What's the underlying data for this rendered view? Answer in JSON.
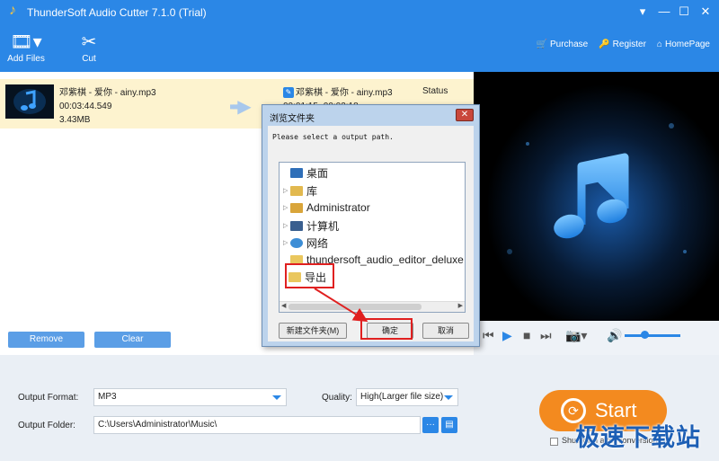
{
  "window": {
    "title": "ThunderSoft Audio Cutter 7.1.0 (Trial)",
    "controls": [
      "▾",
      "—",
      "☐",
      "✕"
    ]
  },
  "toolbar": {
    "add_files": "Add Files",
    "cut": "Cut"
  },
  "nav": {
    "purchase": "Purchase",
    "register": "Register",
    "homepage": "HomePage"
  },
  "file": {
    "source_name": "邓紫棋 - 爱你 - ainy.mp3",
    "source_duration": "00:03:44.549",
    "source_size": "3.43MB",
    "output_name": "邓紫棋 - 爱你 - ainy.mp3",
    "output_range": "00:01:15~00:02:18",
    "status_label": "Status"
  },
  "list_buttons": {
    "remove": "Remove",
    "clear": "Clear"
  },
  "settings": {
    "output_format_label": "Output Format:",
    "output_format_value": "MP3",
    "quality_label": "Quality:",
    "quality_value": "High(Larger file size)",
    "output_folder_label": "Output Folder:",
    "output_folder_value": "C:\\Users\\Administrator\\Music\\",
    "browse": "···",
    "open_folder": "▤"
  },
  "start": {
    "label": "Start",
    "checkbox_label": "Shutdown after conversion"
  },
  "dialog": {
    "title": "浏览文件夹",
    "close": "✕",
    "message": "Please select a output path.",
    "tree": [
      {
        "label": "桌面",
        "expander": ""
      },
      {
        "label": "库",
        "expander": "▷"
      },
      {
        "label": "Administrator",
        "expander": "▷"
      },
      {
        "label": "计算机",
        "expander": "▷"
      },
      {
        "label": "网络",
        "expander": "▷"
      },
      {
        "label": "thundersoft_audio_editor_deluxe",
        "expander": ""
      },
      {
        "label": "导出",
        "expander": ""
      }
    ],
    "new_folder": "新建文件夹(M)",
    "ok": "确定",
    "cancel": "取消"
  },
  "watermark": "极速下载站",
  "colors": {
    "header": "#2b87e6",
    "accent_orange": "#f38a1f",
    "highlight_red": "#e02020"
  }
}
